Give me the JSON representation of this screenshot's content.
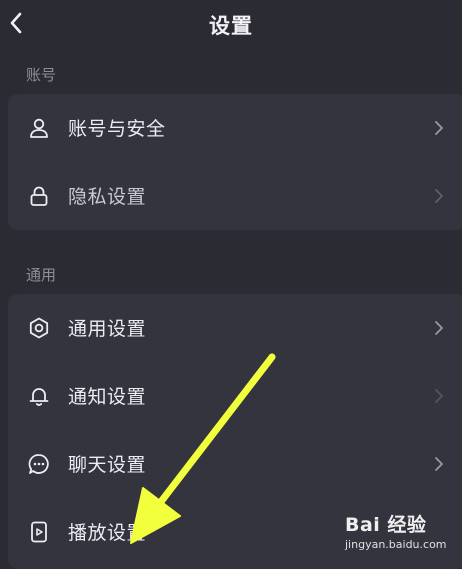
{
  "header": {
    "title": "设置",
    "back_icon": "chevron-left-icon"
  },
  "sections": [
    {
      "label": "账号",
      "items": [
        {
          "label": "账号与安全",
          "icon": "user-icon"
        },
        {
          "label": "隐私设置",
          "icon": "lock-icon"
        }
      ]
    },
    {
      "label": "通用",
      "items": [
        {
          "label": "通用设置",
          "icon": "gear-icon"
        },
        {
          "label": "通知设置",
          "icon": "bell-icon"
        },
        {
          "label": "聊天设置",
          "icon": "chat-bubble-icon"
        },
        {
          "label": "播放设置",
          "icon": "phone-play-icon"
        }
      ]
    }
  ],
  "annotation": {
    "arrow_color": "#f2ff3c"
  },
  "watermark": {
    "logo": "Bai 经验",
    "url": "jingyan.baidu.com"
  },
  "colors": {
    "background": "#2b2b34",
    "card": "#34343e",
    "text": "#ececf2",
    "section_label": "#8e8e98"
  }
}
